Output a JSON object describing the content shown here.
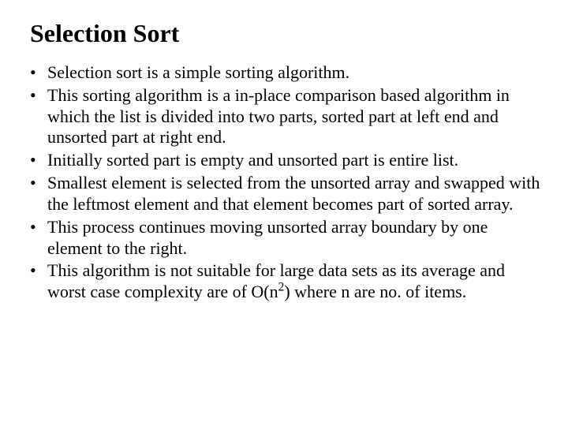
{
  "title": "Selection Sort",
  "bullets": [
    "Selection sort is a simple sorting algorithm.",
    "This sorting algorithm is a in-place comparison based algorithm in which the list is divided into two parts, sorted part at left end and unsorted part at right end.",
    "Initially sorted part is empty and unsorted part is entire list.",
    "Smallest element is selected from the unsorted array and swapped with the leftmost element and that element becomes part of sorted array.",
    "This process continues moving unsorted array boundary by one element to the right.",
    {
      "pre": "This algorithm is not suitable for large data sets as its average and worst case complexity are of O(n",
      "sup": "2",
      "post": ") where n are no. of items."
    }
  ]
}
